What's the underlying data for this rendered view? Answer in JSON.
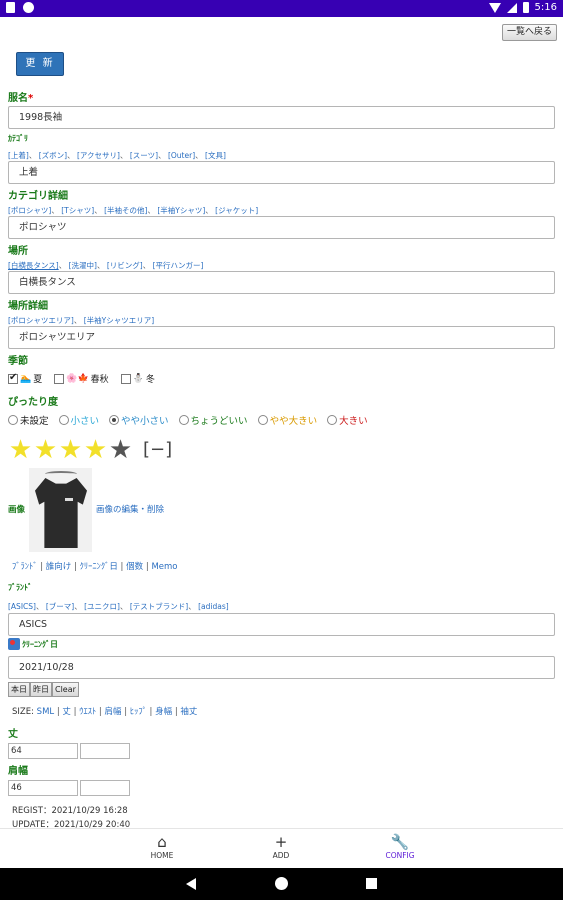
{
  "status_bar": {
    "time": "5:16"
  },
  "header": {
    "back_label": "一覧へ戻る",
    "update_label": "更 新"
  },
  "form": {
    "name": {
      "label": "服名",
      "required_mark": "*",
      "value": "1998長袖"
    },
    "category": {
      "label": "ｶﾃｺﾞﾘ",
      "options": [
        "[上着]",
        "[ズボン]",
        "[アクセサリ]",
        "[スーツ]",
        "[Outer]",
        "[文具]"
      ],
      "value": "上着"
    },
    "category_detail": {
      "label": "カテゴリ詳細",
      "options": [
        "[ポロシャツ]",
        "[Tシャツ]",
        "[半袖その他]",
        "[半袖Yシャツ]",
        "[ジャケット]"
      ],
      "value": "ポロシャツ"
    },
    "place": {
      "label": "場所",
      "options": [
        "[白横長タンス]",
        "[洗濯中]",
        "[リビング]",
        "[平行ハンガー]"
      ],
      "value": "白横長タンス"
    },
    "place_detail": {
      "label": "場所詳細",
      "options": [
        "[ポロシャツエリア]",
        "[半袖Yシャツエリア]"
      ],
      "value": "ポロシャツエリア"
    },
    "season": {
      "label": "季節",
      "items": [
        {
          "label": "夏",
          "checked": true,
          "emoji": "🏊"
        },
        {
          "label": "春秋",
          "checked": false,
          "emoji": "🌸🍁"
        },
        {
          "label": "冬",
          "checked": false,
          "emoji": "⛄"
        }
      ]
    },
    "fit": {
      "label": "ぴったり度",
      "items": [
        {
          "label": "未設定",
          "selected": false,
          "color": "#222222"
        },
        {
          "label": "小さい",
          "selected": false,
          "color": "#2aa7d6"
        },
        {
          "label": "やや小さい",
          "selected": true,
          "color": "#2a8bc9"
        },
        {
          "label": "ちょうどいい",
          "selected": false,
          "color": "#1a7a1a"
        },
        {
          "label": "やや大きい",
          "selected": false,
          "color": "#d99a00"
        },
        {
          "label": "大きい",
          "selected": false,
          "color": "#cc1f1f"
        }
      ]
    },
    "rating": {
      "value": 4,
      "max": 5,
      "minus_label": "[−]"
    },
    "image": {
      "label": "画像",
      "edit_label": "画像の編集・削除"
    },
    "detail_tabs": [
      "ﾌﾞﾗﾝﾄﾞ",
      "誰向け",
      "ｸﾘｰﾆﾝｸﾞ日",
      "個数",
      "Memo"
    ],
    "brand": {
      "label": "ﾌﾞﾗﾝﾄﾞ",
      "options": [
        "[ASICS]",
        "[ブーマ]",
        "[ユニクロ]",
        "[テストブランド]",
        "[adidas]"
      ],
      "value": "ASICS"
    },
    "cleaning": {
      "label": "ｸﾘｰﾆﾝｸﾞ日",
      "value": "2021/10/28",
      "buttons": [
        "本日",
        "昨日",
        "Clear"
      ]
    },
    "size": {
      "prefix": "SIZE:",
      "tabs": [
        "SML",
        "丈",
        "ｳｴｽﾄ",
        "肩幅",
        "ﾋｯﾌﾟ",
        "身幅",
        "袖丈"
      ]
    },
    "length": {
      "label": "丈",
      "value": "64",
      "value2": ""
    },
    "shoulder": {
      "label": "肩幅",
      "value": "46",
      "value2": ""
    },
    "regist": "REGIST：2021/10/29 16:28",
    "update": "UPDATE：2021/10/29 20:40"
  },
  "bottom_nav": [
    {
      "label": "HOME",
      "icon": "home-icon"
    },
    {
      "label": "ADD",
      "icon": "plus-icon"
    },
    {
      "label": "CONFIG",
      "icon": "wrench-icon",
      "active": true
    }
  ]
}
